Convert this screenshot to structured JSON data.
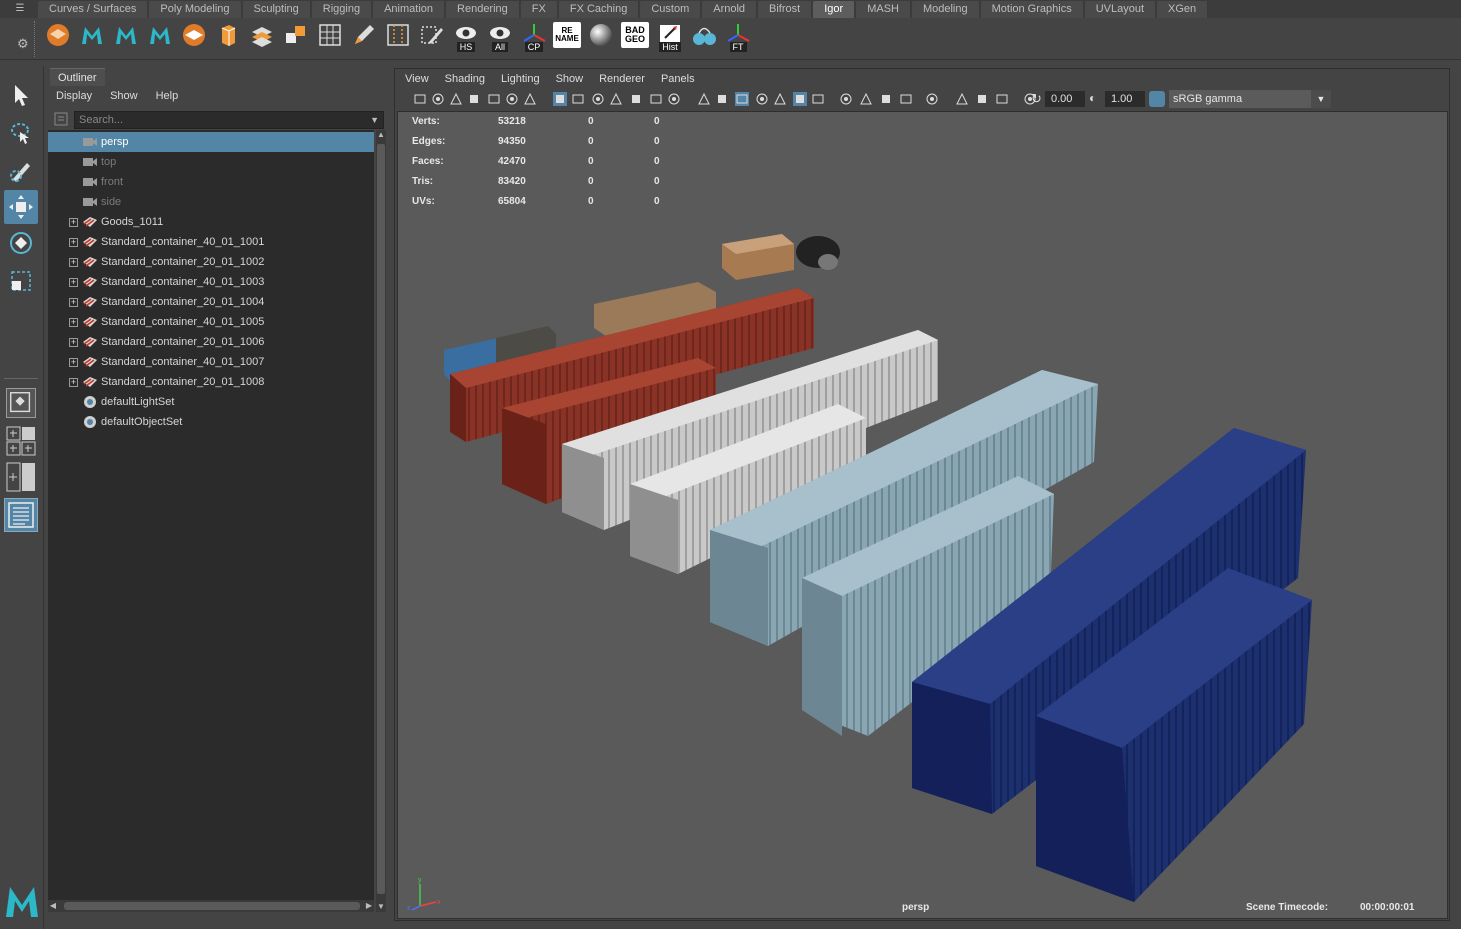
{
  "shelf_tabs": [
    "Curves / Surfaces",
    "Poly Modeling",
    "Sculpting",
    "Rigging",
    "Animation",
    "Rendering",
    "FX",
    "FX Caching",
    "Custom",
    "Arnold",
    "Bifrost",
    "Igor",
    "MASH",
    "Modeling",
    "Motion Graphics",
    "UVLayout",
    "XGen"
  ],
  "active_shelf_tab": "Igor",
  "shelf_buttons": {
    "hs_label": "HS",
    "all_label": "All",
    "cp_label": "CP",
    "rename_label": "RE NAME",
    "badgeo_label": "BAD GEO",
    "hist_label": "Hist",
    "ft_label": "FT"
  },
  "outliner": {
    "title": "Outliner",
    "menus": [
      "Display",
      "Show",
      "Help"
    ],
    "search_placeholder": "Search...",
    "items": [
      {
        "label": "persp",
        "type": "camera",
        "selected": true,
        "dim": false,
        "expandable": false
      },
      {
        "label": "top",
        "type": "camera",
        "selected": false,
        "dim": true,
        "expandable": false
      },
      {
        "label": "front",
        "type": "camera",
        "selected": false,
        "dim": true,
        "expandable": false
      },
      {
        "label": "side",
        "type": "camera",
        "selected": false,
        "dim": true,
        "expandable": false
      },
      {
        "label": "Goods_1011",
        "type": "group",
        "selected": false,
        "dim": false,
        "expandable": true
      },
      {
        "label": "Standard_container_40_01_1001",
        "type": "group",
        "selected": false,
        "dim": false,
        "expandable": true
      },
      {
        "label": "Standard_container_20_01_1002",
        "type": "group",
        "selected": false,
        "dim": false,
        "expandable": true
      },
      {
        "label": "Standard_container_40_01_1003",
        "type": "group",
        "selected": false,
        "dim": false,
        "expandable": true
      },
      {
        "label": "Standard_container_20_01_1004",
        "type": "group",
        "selected": false,
        "dim": false,
        "expandable": true
      },
      {
        "label": "Standard_container_40_01_1005",
        "type": "group",
        "selected": false,
        "dim": false,
        "expandable": true
      },
      {
        "label": "Standard_container_20_01_1006",
        "type": "group",
        "selected": false,
        "dim": false,
        "expandable": true
      },
      {
        "label": "Standard_container_40_01_1007",
        "type": "group",
        "selected": false,
        "dim": false,
        "expandable": true
      },
      {
        "label": "Standard_container_20_01_1008",
        "type": "group",
        "selected": false,
        "dim": false,
        "expandable": true
      },
      {
        "label": "defaultLightSet",
        "type": "set",
        "selected": false,
        "dim": false,
        "expandable": false
      },
      {
        "label": "defaultObjectSet",
        "type": "set",
        "selected": false,
        "dim": false,
        "expandable": false
      }
    ]
  },
  "viewport": {
    "menus": [
      "View",
      "Shading",
      "Lighting",
      "Show",
      "Renderer",
      "Panels"
    ],
    "exposure": "0.00",
    "gamma": "1.00",
    "color_space": "sRGB gamma",
    "hud": [
      {
        "label": "Verts:",
        "v1": "53218",
        "v2": "0",
        "v3": "0"
      },
      {
        "label": "Edges:",
        "v1": "94350",
        "v2": "0",
        "v3": "0"
      },
      {
        "label": "Faces:",
        "v1": "42470",
        "v2": "0",
        "v3": "0"
      },
      {
        "label": "Tris:",
        "v1": "83420",
        "v2": "0",
        "v3": "0"
      },
      {
        "label": "UVs:",
        "v1": "65804",
        "v2": "0",
        "v3": "0"
      }
    ],
    "camera_name": "persp",
    "timecode_label": "Scene Timecode:",
    "timecode_value": "00:00:00:01",
    "axis_labels": {
      "x": "x",
      "y": "y",
      "z": "z"
    }
  },
  "colors": {
    "accent": "#5285a6",
    "panel": "#444444",
    "viewport_bg": "#5a5a5a",
    "container_red": "#8a3226",
    "container_white": "#c9c9c9",
    "container_lightblue": "#8aa6b3",
    "container_navy": "#1c2f6e"
  },
  "icons": {
    "tools": [
      "select-arrow-icon",
      "lasso-icon",
      "paint-select-icon",
      "move-icon",
      "rotate-icon",
      "scale-icon"
    ],
    "layouts": [
      "single-pane-icon",
      "four-pane-icon",
      "two-pane-icon",
      "outliner-pane-icon"
    ]
  }
}
